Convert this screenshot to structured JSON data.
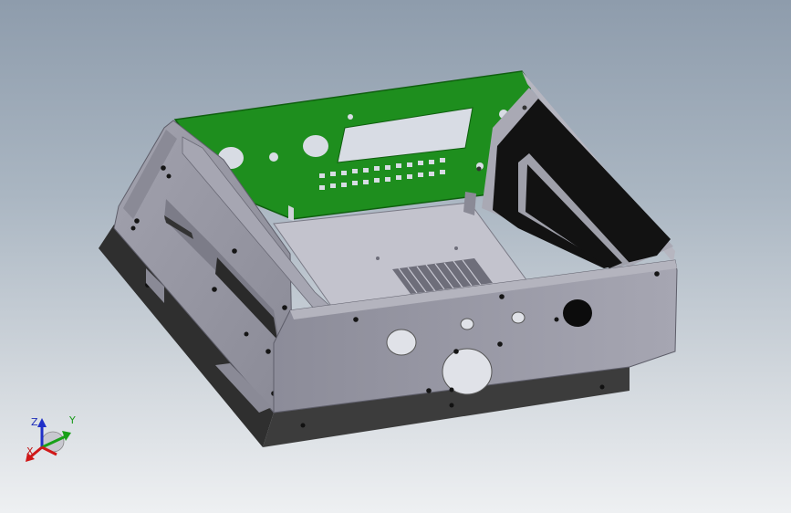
{
  "view": {
    "background_top": "#8e9cac",
    "background_bottom": "#eef0f2"
  },
  "model": {
    "sheet_metal_color": "#9a9aa8",
    "sheet_metal_shadow": "#6c6c78",
    "base_plate_color": "#3a3a3a",
    "pcb_color": "#1e8e1e",
    "pcb_cutout_color": "#d8dce4",
    "rear_panel_color": "#101010"
  },
  "triad": {
    "z_label": "Z",
    "y_label": "Y",
    "x_label": "X",
    "x_color": "#d01818",
    "y_color": "#18a018",
    "z_color": "#1f2fc8"
  }
}
